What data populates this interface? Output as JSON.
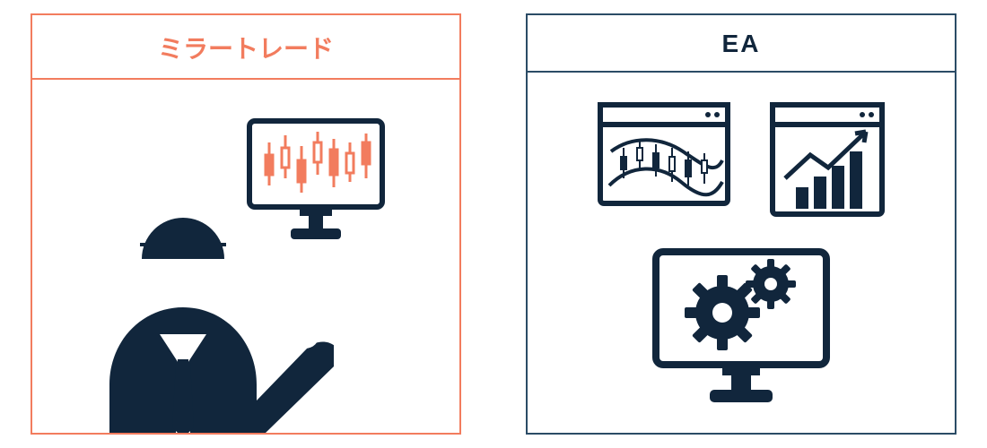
{
  "panels": {
    "mirror": {
      "title": "ミラートレード"
    },
    "ea": {
      "title": "EA"
    }
  },
  "palette": {
    "accent": "#F27C5E",
    "navy": "#11263C",
    "border": "#2B4C66",
    "white": "#FFFFFF"
  }
}
